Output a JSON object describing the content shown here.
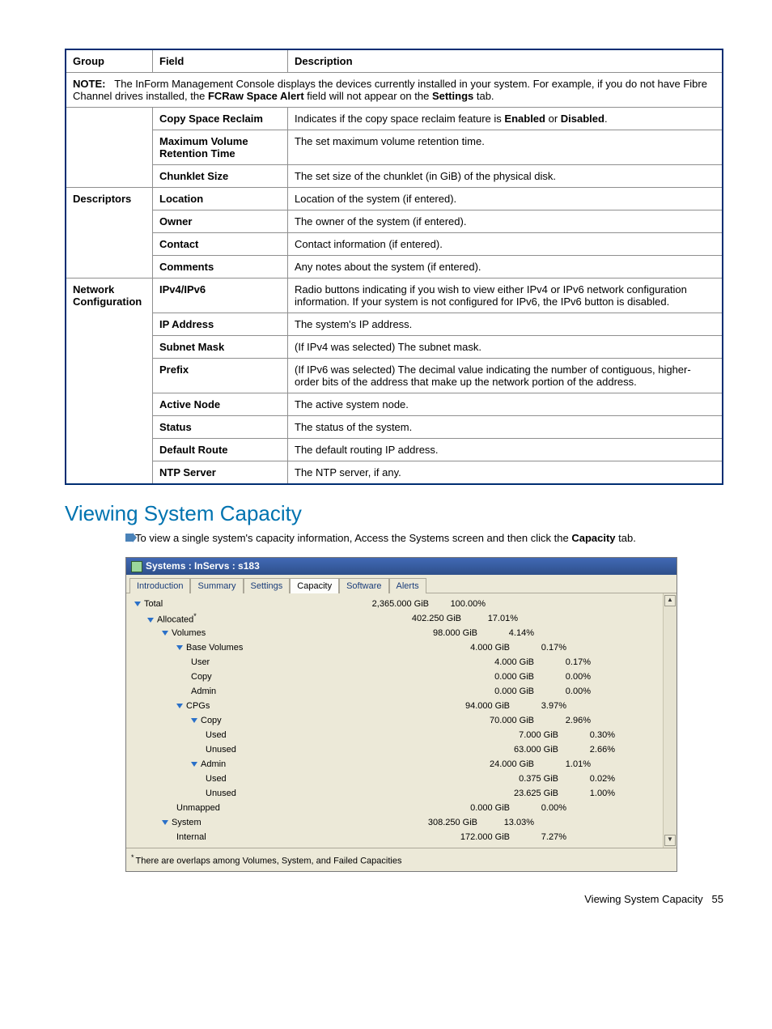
{
  "table": {
    "headers": {
      "group": "Group",
      "field": "Field",
      "description": "Description"
    },
    "note": {
      "label": "NOTE:",
      "text_a": "The InForm Management Console displays the devices currently installed in your system. For example, if you do not have Fibre Channel drives installed, the ",
      "bold1": "FCRaw Space Alert",
      "text_b": " field will not appear on the ",
      "bold2": "Settings",
      "text_c": " tab."
    },
    "rows": [
      {
        "group": "",
        "field": "Copy Space Reclaim",
        "desc_a": "Indicates if the copy space reclaim feature is ",
        "bold1": "Enabled",
        "desc_b": " or ",
        "bold2": "Disabled",
        "desc_c": "."
      },
      {
        "group": "",
        "field": "Maximum Volume Retention Time",
        "desc_a": "The set maximum volume retention time."
      },
      {
        "group": "",
        "field": "Chunklet Size",
        "desc_a": "The set size of the chunklet (in GiB) of the physical disk."
      },
      {
        "group": "Descriptors",
        "field": "Location",
        "desc_a": "Location of the system (if entered)."
      },
      {
        "group": "",
        "field": "Owner",
        "desc_a": "The owner of the system (if entered)."
      },
      {
        "group": "",
        "field": "Contact",
        "desc_a": "Contact information (if entered)."
      },
      {
        "group": "",
        "field": "Comments",
        "desc_a": "Any notes about the system (if entered)."
      },
      {
        "group": "Network Configuration",
        "field": "IPv4/IPv6",
        "desc_a": "Radio buttons indicating if you wish to view either IPv4 or IPv6 network configuration information. If your system is not configured for IPv6, the IPv6 button is disabled."
      },
      {
        "group": "",
        "field": "IP Address",
        "desc_a": "The system's IP address."
      },
      {
        "group": "",
        "field": "Subnet Mask",
        "desc_a": "(If IPv4 was selected) The subnet mask."
      },
      {
        "group": "",
        "field": "Prefix",
        "desc_a": "(If IPv6 was selected) The decimal value indicating the number of contiguous, higher-order bits of the address that make up the network portion of the address."
      },
      {
        "group": "",
        "field": "Active Node",
        "desc_a": "The active system node."
      },
      {
        "group": "",
        "field": "Status",
        "desc_a": "The status of the system."
      },
      {
        "group": "",
        "field": "Default Route",
        "desc_a": "The default routing IP address."
      },
      {
        "group": "",
        "field": "NTP Server",
        "desc_a": "The NTP server, if any."
      }
    ]
  },
  "section": {
    "title": "Viewing System Capacity",
    "intro_a": "To view a single system's capacity information, Access the Systems screen and then click the ",
    "intro_bold": "Capacity",
    "intro_b": " tab."
  },
  "app": {
    "title": "Systems : InServs : s183",
    "tabs": [
      "Introduction",
      "Summary",
      "Settings",
      "Capacity",
      "Software",
      "Alerts"
    ],
    "active_tab": 3,
    "rows": [
      {
        "ind": 0,
        "tri": true,
        "label": "Total",
        "size": "2,365.000 GiB",
        "pct": "100.00%"
      },
      {
        "ind": 1,
        "tri": true,
        "label": "Allocated",
        "ast": true,
        "size": "402.250 GiB",
        "pct": "17.01%"
      },
      {
        "ind": 2,
        "tri": true,
        "label": "Volumes",
        "size": "98.000 GiB",
        "pct": "4.14%"
      },
      {
        "ind": 3,
        "tri": true,
        "label": "Base Volumes",
        "size": "4.000 GiB",
        "pct": "0.17%"
      },
      {
        "ind": 4,
        "tri": false,
        "label": "User",
        "size": "4.000 GiB",
        "pct": "0.17%"
      },
      {
        "ind": 4,
        "tri": false,
        "label": "Copy",
        "size": "0.000 GiB",
        "pct": "0.00%"
      },
      {
        "ind": 4,
        "tri": false,
        "label": "Admin",
        "size": "0.000 GiB",
        "pct": "0.00%"
      },
      {
        "ind": 3,
        "tri": true,
        "label": "CPGs",
        "size": "94.000 GiB",
        "pct": "3.97%"
      },
      {
        "ind": 4,
        "tri": true,
        "label": "Copy",
        "size": "70.000 GiB",
        "pct": "2.96%"
      },
      {
        "ind": 5,
        "tri": false,
        "label": "Used",
        "size": "7.000 GiB",
        "pct": "0.30%"
      },
      {
        "ind": 5,
        "tri": false,
        "label": "Unused",
        "size": "63.000 GiB",
        "pct": "2.66%"
      },
      {
        "ind": 4,
        "tri": true,
        "label": "Admin",
        "size": "24.000 GiB",
        "pct": "1.01%"
      },
      {
        "ind": 5,
        "tri": false,
        "label": "Used",
        "size": "0.375 GiB",
        "pct": "0.02%"
      },
      {
        "ind": 5,
        "tri": false,
        "label": "Unused",
        "size": "23.625 GiB",
        "pct": "1.00%"
      },
      {
        "ind": 3,
        "tri": false,
        "label": "Unmapped",
        "size": "0.000 GiB",
        "pct": "0.00%"
      },
      {
        "ind": 2,
        "tri": true,
        "label": "System",
        "size": "308.250 GiB",
        "pct": "13.03%"
      },
      {
        "ind": 3,
        "tri": false,
        "label": "Internal",
        "size": "172.000 GiB",
        "pct": "7.27%"
      }
    ],
    "footnote": "There are overlaps among Volumes, System, and Failed Capacities"
  },
  "footer": {
    "text": "Viewing System Capacity",
    "page": "55"
  }
}
